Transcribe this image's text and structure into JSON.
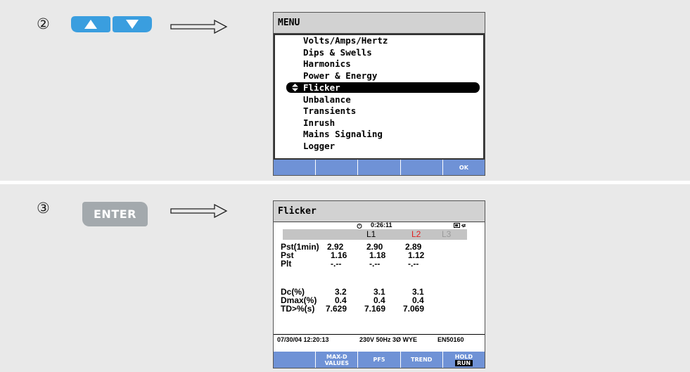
{
  "step2": {
    "number": "②",
    "arrow_icon": "long-right-arrow",
    "keys": [
      {
        "icon": "up-triangle",
        "color": "#3a9edf"
      },
      {
        "icon": "down-triangle",
        "color": "#3a9edf"
      }
    ],
    "menu_screen": {
      "title": "MENU",
      "items": [
        "Volts/Amps/Hertz",
        "Dips & Swells",
        "Harmonics",
        "Power & Energy",
        "Flicker",
        "Unbalance",
        "Transients",
        "Inrush",
        "Mains Signaling",
        "Logger"
      ],
      "selected_index": 4,
      "selector_icon": "up-down-arrows",
      "softkeys": [
        "",
        "",
        "",
        "",
        "OK"
      ]
    }
  },
  "step3": {
    "number": "③",
    "enter_label": "ENTER",
    "arrow_icon": "long-right-arrow",
    "flicker_screen": {
      "title": "Flicker",
      "timer": "0:26:11",
      "timer_icon": "stopwatch-icon",
      "battery_icon": "battery-plug-icon",
      "phases": [
        "L1",
        "L2",
        "L3"
      ],
      "phase_colors": [
        "#000000",
        "#e02020",
        "#9a9a9a"
      ],
      "rows": [
        {
          "label": "Pst(1min)",
          "values": [
            "2.92",
            "2.90",
            "2.89"
          ]
        },
        {
          "label": "Pst",
          "values": [
            "1.16",
            "1.18",
            "1.12"
          ]
        },
        {
          "label": "Plt",
          "values": [
            "-.--",
            "-.--",
            "-.--"
          ]
        },
        {
          "label": "Dc(%)",
          "values": [
            "3.2",
            "3.1",
            "3.1"
          ]
        },
        {
          "label": "Dmax(%)",
          "values": [
            "0.4",
            "0.4",
            "0.4"
          ]
        },
        {
          "label": "TD>%(s)",
          "values": [
            "7.629",
            "7.169",
            "7.069"
          ]
        }
      ],
      "status": {
        "datetime": "07/30/04 12:20:13",
        "config": "230V 50Hz 3Ø WYE",
        "standard": "EN50160"
      },
      "softkeys": [
        {
          "top": "",
          "bottom": ""
        },
        {
          "top": "MAX-D",
          "bottom": "VALUES"
        },
        {
          "top": "PF5",
          "bottom": ""
        },
        {
          "top": "TREND",
          "bottom": ""
        },
        {
          "top": "HOLD",
          "bottom": "RUN"
        }
      ]
    }
  }
}
